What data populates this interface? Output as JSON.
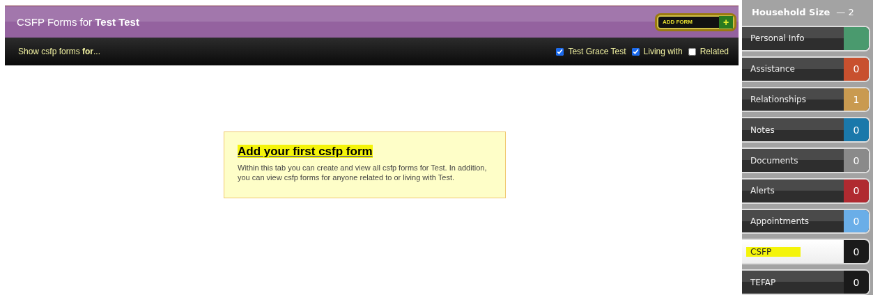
{
  "header": {
    "title_prefix": "CSFP Forms for ",
    "title_name": "Test Test",
    "add_button": "ADD FORM",
    "add_icon": "+"
  },
  "filter_bar": {
    "label": "Show csfp forms **for**...",
    "options": [
      {
        "label": "Test Grace Test",
        "checked": true
      },
      {
        "label": "Living with",
        "checked": true
      },
      {
        "label": "Related",
        "checked": false
      }
    ]
  },
  "empty_state": {
    "heading": "Add your first csfp form",
    "highlighted": true,
    "text": "Within this tab you can create and view all csfp forms for Test. In addition, you can view csfp forms for anyone related to or living with Test."
  },
  "sidebar": {
    "household_label": "Household Size",
    "household_value": "— 2",
    "items": [
      {
        "label": "Personal Info",
        "color": "#4a9a6e",
        "selected": false,
        "highlighted": false
      },
      {
        "label": "Assistance",
        "count": "0",
        "color": "#c8502e",
        "selected": false,
        "highlighted": false
      },
      {
        "label": "Relationships",
        "count": "1",
        "color": "#c99a50",
        "selected": false,
        "highlighted": false
      },
      {
        "label": "Notes",
        "count": "0",
        "color": "#1a78aa",
        "selected": false,
        "highlighted": false
      },
      {
        "label": "Documents",
        "count": "0",
        "color": "#8a8a8a",
        "selected": false,
        "highlighted": false
      },
      {
        "label": "Alerts",
        "count": "0",
        "color": "#b02a30",
        "selected": false,
        "highlighted": false
      },
      {
        "label": "Appointments",
        "count": "0",
        "color": "#6aaee8",
        "selected": false,
        "highlighted": false
      },
      {
        "label": "CSFP",
        "count": "0",
        "color": "#1a1a1a",
        "selected": true,
        "highlighted": true
      },
      {
        "label": "TEFAP",
        "count": "0",
        "color": "#1a1a1a",
        "selected": false,
        "highlighted": false
      }
    ]
  }
}
